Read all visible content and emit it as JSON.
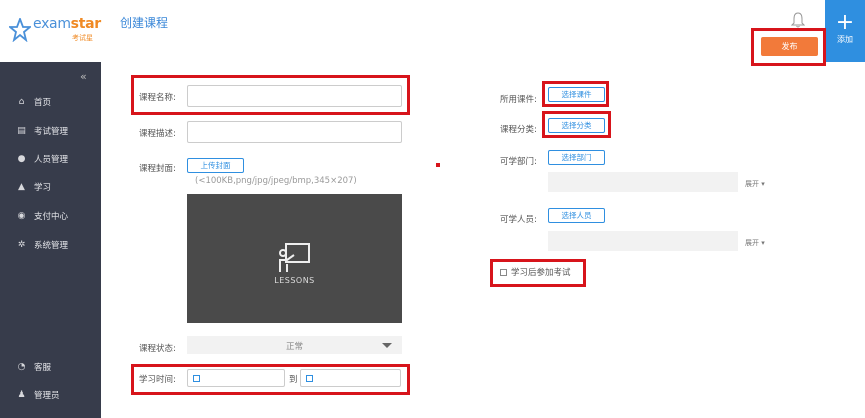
{
  "logo": {
    "brand_a": "exam",
    "brand_b": "star",
    "sub": "考试星"
  },
  "header": {
    "title": "创建课程",
    "add_label": "添加",
    "publish_label": "发布"
  },
  "sidebar": {
    "items": [
      {
        "label": "首页",
        "icon": "home-icon"
      },
      {
        "label": "考试管理",
        "icon": "document-icon"
      },
      {
        "label": "人员管理",
        "icon": "users-icon"
      },
      {
        "label": "学习",
        "icon": "graduation-cap-icon"
      },
      {
        "label": "支付中心",
        "icon": "money-icon"
      },
      {
        "label": "系统管理",
        "icon": "gears-icon"
      }
    ],
    "bottom": [
      {
        "label": "客服",
        "icon": "headset-icon"
      },
      {
        "label": "管理员",
        "icon": "user-icon"
      }
    ]
  },
  "form": {
    "name_label": "课程名称:",
    "desc_label": "课程描述:",
    "cover_label": "课程封面:",
    "upload_btn": "上传封面",
    "upload_hint": "(<100KB,png/jpg/jpeg/bmp,345×207)",
    "cover_text": "LESSONS",
    "status_label": "课程状态:",
    "status_value": "正常",
    "time_label": "学习时间:",
    "time_to": "到",
    "courseware_label": "所用课件:",
    "courseware_btn": "选择课件",
    "category_label": "课程分类:",
    "category_btn": "选择分类",
    "dept_label": "可学部门:",
    "dept_btn": "选择部门",
    "people_label": "可学人员:",
    "people_btn": "选择人员",
    "expand_label": "展开",
    "exam_checkbox_label": "学习后参加考试"
  },
  "colors": {
    "accent": "#2f8fe0",
    "highlight": "#d7141b",
    "publish": "#f27a3a",
    "sidebar": "#373c4b"
  }
}
